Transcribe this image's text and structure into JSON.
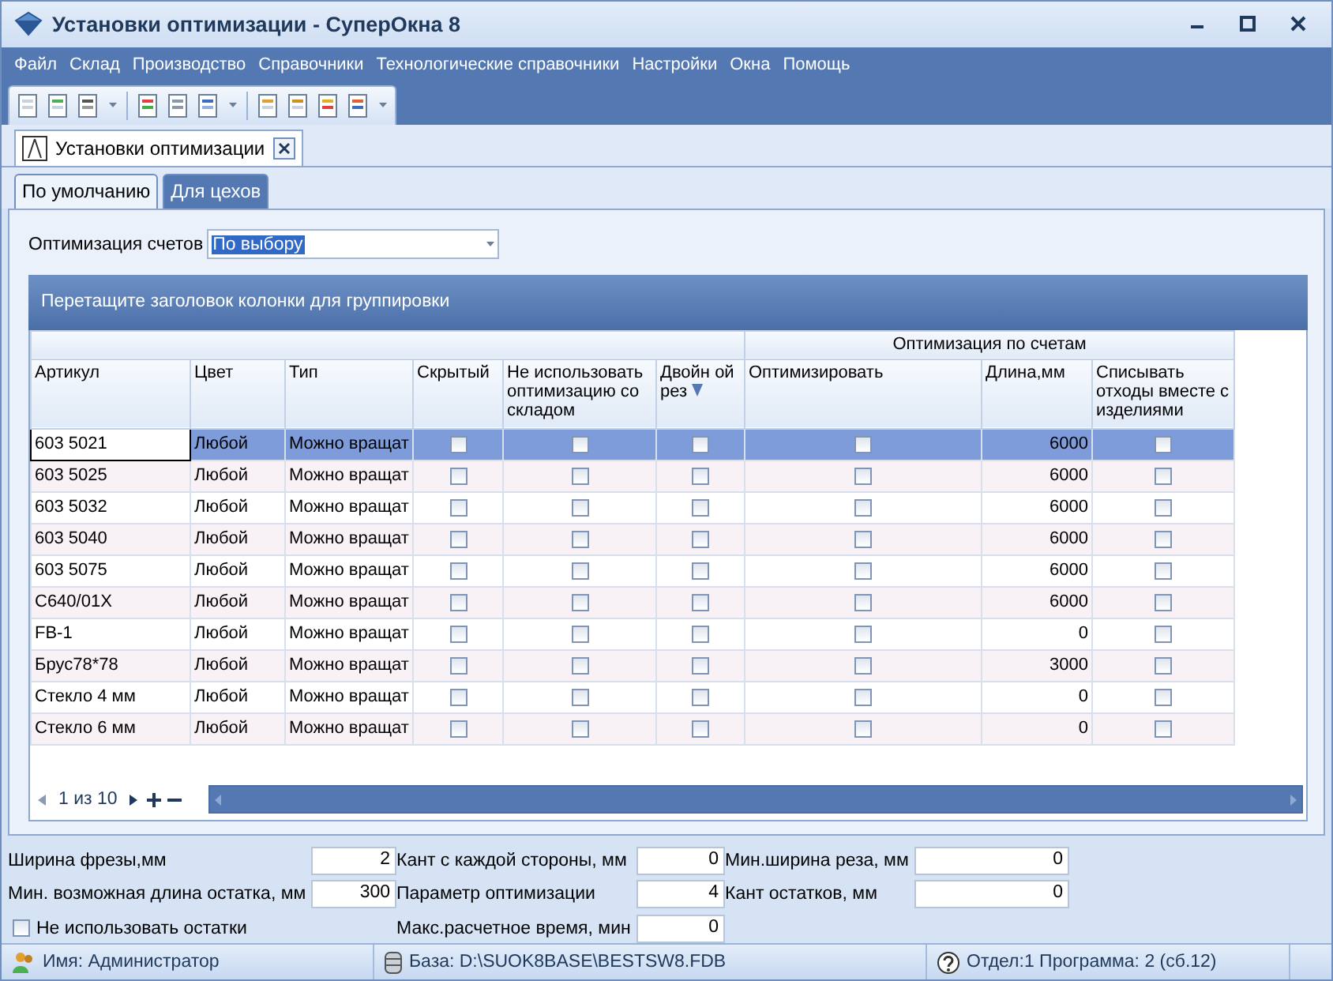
{
  "window": {
    "title": "Установки оптимизации - СуперОкна 8"
  },
  "menu": [
    "Файл",
    "Склад",
    "Производство",
    "Справочники",
    "Технологические справочники",
    "Настройки",
    "Окна",
    "Помощь"
  ],
  "document_tab": {
    "label": "Установки оптимизации"
  },
  "tabs": [
    {
      "label": "По умолчанию",
      "selected": true
    },
    {
      "label": "Для цехов",
      "selected": false
    }
  ],
  "invoice_optimization": {
    "label": "Оптимизация счетов",
    "value": "По выбору"
  },
  "group_panel": "Перетащите заголовок колонки для группировки",
  "table": {
    "group_header": "Оптимизация по счетам",
    "columns": [
      "Артикул",
      "Цвет",
      "Тип",
      "Скрытый",
      "Не использовать оптимизацию со складом",
      "Двойн ой рез",
      "Оптимизировать",
      "Длина,мм",
      "Списывать отходы вместе с изделиями"
    ],
    "rows": [
      {
        "article": "603 5021",
        "finish": "Любой",
        "type": "Можно вращат",
        "hidden": false,
        "no_stock": false,
        "double_cut": false,
        "optimize": false,
        "length": "6000",
        "write_off": false,
        "selected": true
      },
      {
        "article": "603 5025",
        "finish": "Любой",
        "type": "Можно вращат",
        "hidden": false,
        "no_stock": false,
        "double_cut": false,
        "optimize": false,
        "length": "6000",
        "write_off": false,
        "selected": false
      },
      {
        "article": "603 5032",
        "finish": "Любой",
        "type": "Можно вращат",
        "hidden": false,
        "no_stock": false,
        "double_cut": false,
        "optimize": false,
        "length": "6000",
        "write_off": false,
        "selected": false
      },
      {
        "article": "603 5040",
        "finish": "Любой",
        "type": "Можно вращат",
        "hidden": false,
        "no_stock": false,
        "double_cut": false,
        "optimize": false,
        "length": "6000",
        "write_off": false,
        "selected": false
      },
      {
        "article": "603 5075",
        "finish": "Любой",
        "type": "Можно вращат",
        "hidden": false,
        "no_stock": false,
        "double_cut": false,
        "optimize": false,
        "length": "6000",
        "write_off": false,
        "selected": false
      },
      {
        "article": "C640/01X",
        "finish": "Любой",
        "type": "Можно вращат",
        "hidden": false,
        "no_stock": false,
        "double_cut": false,
        "optimize": false,
        "length": "6000",
        "write_off": false,
        "selected": false
      },
      {
        "article": "FB-1",
        "finish": "Любой",
        "type": "Можно вращат",
        "hidden": false,
        "no_stock": false,
        "double_cut": false,
        "optimize": false,
        "length": "0",
        "write_off": false,
        "selected": false
      },
      {
        "article": "Брус78*78",
        "finish": "Любой",
        "type": "Можно вращат",
        "hidden": false,
        "no_stock": false,
        "double_cut": false,
        "optimize": false,
        "length": "3000",
        "write_off": false,
        "selected": false
      },
      {
        "article": "Стекло 4 мм",
        "finish": "Любой",
        "type": "Можно вращат",
        "hidden": false,
        "no_stock": false,
        "double_cut": false,
        "optimize": false,
        "length": "0",
        "write_off": false,
        "selected": false
      },
      {
        "article": "Стекло 6 мм",
        "finish": "Любой",
        "type": "Можно вращат",
        "hidden": false,
        "no_stock": false,
        "double_cut": false,
        "optimize": false,
        "length": "0",
        "write_off": false,
        "selected": false
      }
    ]
  },
  "pager": "1 из 10",
  "params": [
    {
      "label": "Ширина фрезы,мм",
      "value": "2"
    },
    {
      "label": "Кант с каждой стороны, мм",
      "value": "0"
    },
    {
      "label": "Мин.ширина реза, мм",
      "value": "0"
    },
    {
      "label": "Мин. возможная длина остатка, мм",
      "value": "300"
    },
    {
      "label": "Параметр оптимизации",
      "value": "4"
    },
    {
      "label": "Кант остатков, мм",
      "value": "0"
    },
    {
      "label": "Макс.расчетное время, мин",
      "value": "0"
    }
  ],
  "no_remnants": {
    "label": "Не использовать остатки",
    "checked": false
  },
  "status_bar": {
    "user": "Имя: Администратор",
    "database": "База: D:\\SUOK8BASE\\BESTSW8.FDB",
    "info": "Отдел:1 Программа: 2 (сб.12)"
  }
}
